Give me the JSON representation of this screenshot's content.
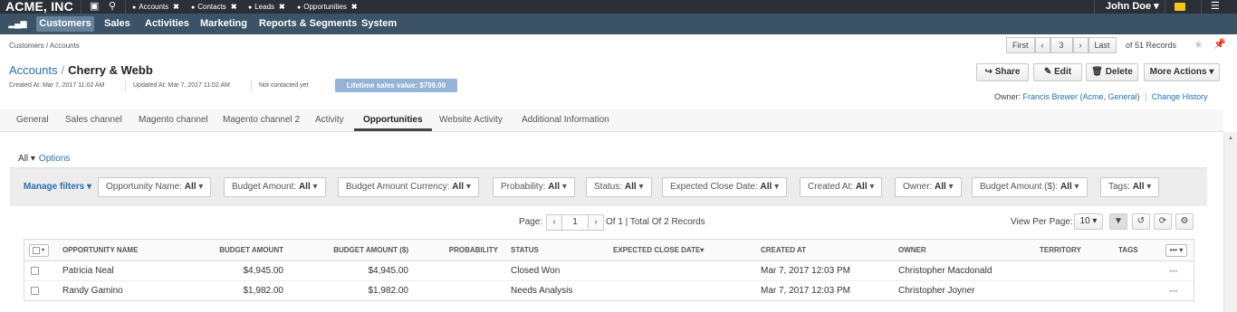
{
  "topbar": {
    "logo": "ACME, INC",
    "pins": [
      "Accounts",
      "Contacts",
      "Leads",
      "Opportunities"
    ],
    "user": "John Doe ▾"
  },
  "nav": {
    "items": [
      "Customers",
      "Sales",
      "Activities",
      "Marketing",
      "Reports & Segments",
      "System"
    ]
  },
  "breadcrumb": "Customers / Accounts",
  "pager_top": {
    "first": "First",
    "prev": "‹",
    "page": "3",
    "next": "›",
    "last": "Last",
    "records": "of 51 Records"
  },
  "title": {
    "entity": "Accounts",
    "separator": "/",
    "name": "Cherry & Webb"
  },
  "meta": {
    "created": "Created At: Mar 7, 2017 11:02 AM",
    "updated": "Updated At: Mar 7, 2017 11:02 AM",
    "contacted": "Not contacted yet",
    "lifetime": "Lifetime sales value: $799.00"
  },
  "actions": {
    "share": "Share",
    "edit": "Edit",
    "delete": "Delete",
    "more": "More Actions ▾"
  },
  "owner": {
    "label": "Owner:",
    "value": "Francis Brewer (Acme, General)",
    "history": "Change History"
  },
  "tabs": [
    "General",
    "Sales channel",
    "Magento channel",
    "Magento channel 2",
    "Activity",
    "Opportunities",
    "Website Activity",
    "Additional Information"
  ],
  "grid_toolbar": {
    "all": "All ▾",
    "options": "Options",
    "manage_filters": "Manage filters ▾",
    "filters": [
      {
        "label": "Opportunity Name:",
        "value": "All"
      },
      {
        "label": "Budget Amount:",
        "value": "All"
      },
      {
        "label": "Budget Amount Currency:",
        "value": "All"
      },
      {
        "label": "Probability:",
        "value": "All"
      },
      {
        "label": "Status:",
        "value": "All"
      },
      {
        "label": "Expected Close Date:",
        "value": "All"
      },
      {
        "label": "Created At:",
        "value": "All"
      },
      {
        "label": "Owner:",
        "value": "All"
      },
      {
        "label": "Budget Amount ($):",
        "value": "All"
      },
      {
        "label": "Tags:",
        "value": "All"
      }
    ],
    "page_label": "Page:",
    "page": "1",
    "page_info": "Of 1 | Total Of 2 Records",
    "view_per_page": "View Per Page:",
    "per_page": "10 ▾"
  },
  "grid": {
    "columns": [
      "Opportunity Name",
      "Budget Amount",
      "Budget Amount ($)",
      "Probability",
      "Status",
      "Expected Close Date▾",
      "Created At",
      "Owner",
      "Territory",
      "Tags"
    ],
    "rows": [
      {
        "name": "Patricia Neal",
        "budget": "$4,945.00",
        "budget_usd": "$4,945.00",
        "probability": "",
        "status": "Closed Won",
        "close_date": "",
        "created": "Mar 7, 2017 12:03 PM",
        "owner": "Christopher Macdonald",
        "territory": "",
        "tags": ""
      },
      {
        "name": "Randy Gamino",
        "budget": "$1,982.00",
        "budget_usd": "$1,982.00",
        "probability": "",
        "status": "Needs Analysis",
        "close_date": "",
        "created": "Mar 7, 2017 12:03 PM",
        "owner": "Christopher Joyner",
        "territory": "",
        "tags": ""
      }
    ]
  }
}
